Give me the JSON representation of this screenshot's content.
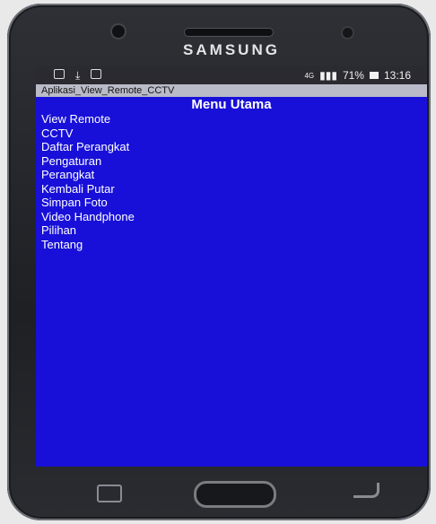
{
  "device": {
    "brand": "SAMSUNG"
  },
  "status_bar": {
    "network": "4G",
    "battery_percent": "71%",
    "time": "13:16"
  },
  "app": {
    "title": "Aplikasi_View_Remote_CCTV",
    "menu_heading": "Menu Utama",
    "menu_items": [
      "View Remote",
      "CCTV",
      "Daftar Perangkat",
      "Pengaturan",
      "Perangkat",
      "Kembali Putar",
      "Simpan Foto",
      "Video Handphone",
      "Pilihan",
      "Tentang"
    ]
  },
  "colors": {
    "screen_background": "#1810d8",
    "title_bar": "#b9bcc8",
    "status_bar": "#2a2a30"
  }
}
